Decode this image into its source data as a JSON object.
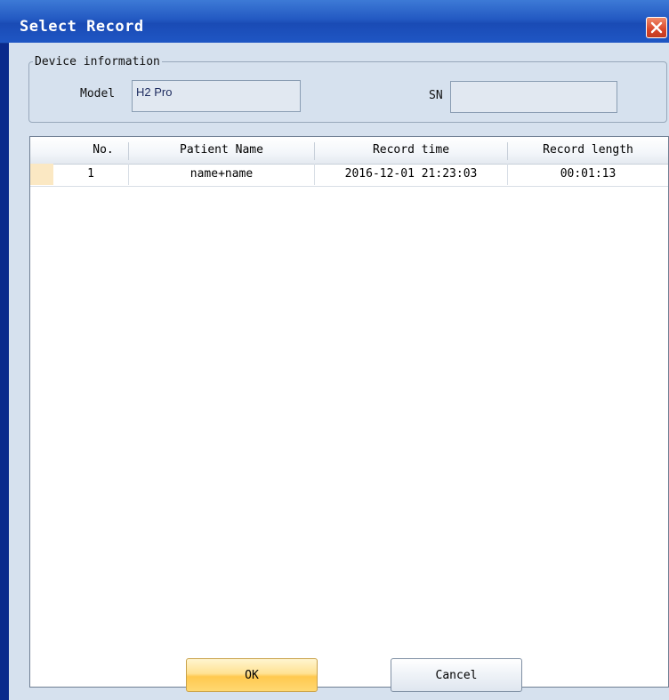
{
  "window": {
    "title": "Select Record"
  },
  "device": {
    "legend": "Device information",
    "model_label": "Model",
    "model_value": "H2 Pro",
    "sn_label": "SN",
    "sn_value": ""
  },
  "table": {
    "columns": [
      "No.",
      "Patient Name",
      "Record time",
      "Record length"
    ],
    "rows": [
      {
        "no": "1",
        "patient_name": "name+name",
        "record_time": "2016-12-01 21:23:03",
        "record_length": "00:01:13"
      }
    ]
  },
  "buttons": {
    "ok_label": "OK",
    "cancel_label": "Cancel"
  },
  "icons": {
    "close": "close-icon"
  }
}
